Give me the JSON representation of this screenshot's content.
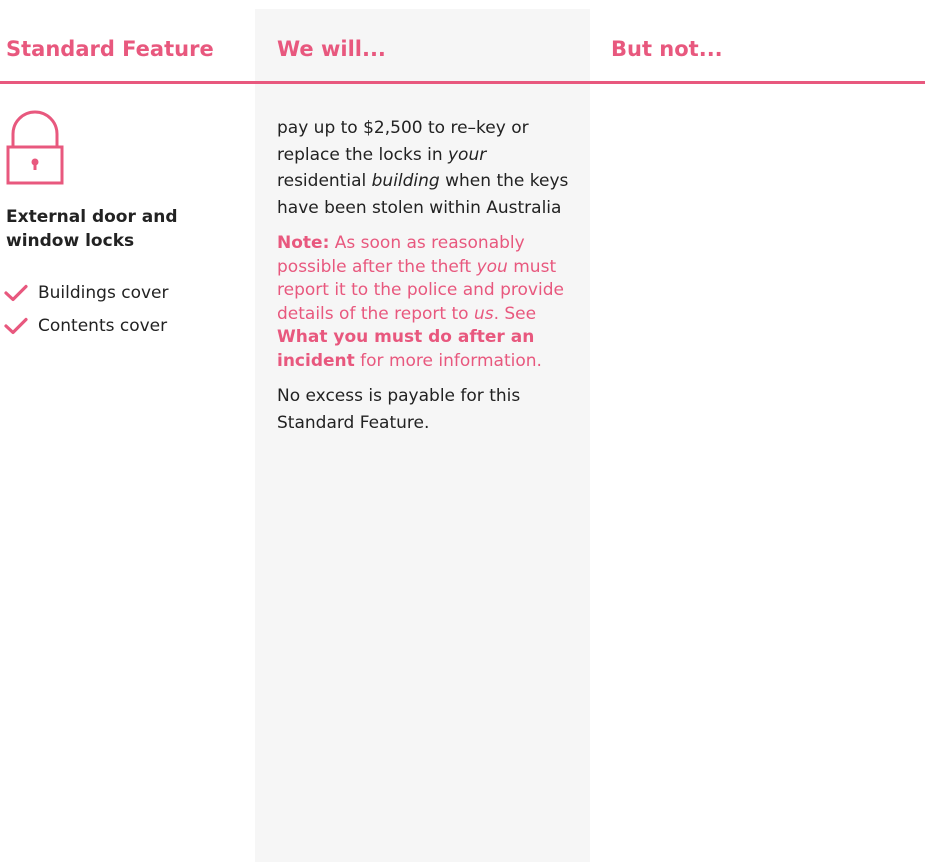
{
  "headers": {
    "standard_feature": "Standard Feature",
    "we_will": "We will...",
    "but_not": "But not..."
  },
  "feature": {
    "icon": "lock-icon",
    "title": "External door and window locks",
    "covers": [
      "Buildings cover",
      "Contents cover"
    ]
  },
  "we_will": {
    "p1_a": "pay up to $2,500 to re–key or replace the locks in ",
    "p1_your": "your",
    "p1_b": " residential ",
    "p1_building": "building",
    "p1_c": " when the keys have been stolen within Australia",
    "note_label": "Note:",
    "note_a": " As soon as reasonably possible after the theft ",
    "note_you": "you",
    "note_b": " must report it to the police and provide details of the report to ",
    "note_us": "us",
    "note_c": ". See ",
    "note_link": "What you must do after an incident",
    "note_d": " for more information.",
    "excess": "No excess is payable for this Standard Feature."
  },
  "colors": {
    "accent": "#e8587e",
    "column_shade": "#f6f6f6",
    "text": "#222222"
  }
}
